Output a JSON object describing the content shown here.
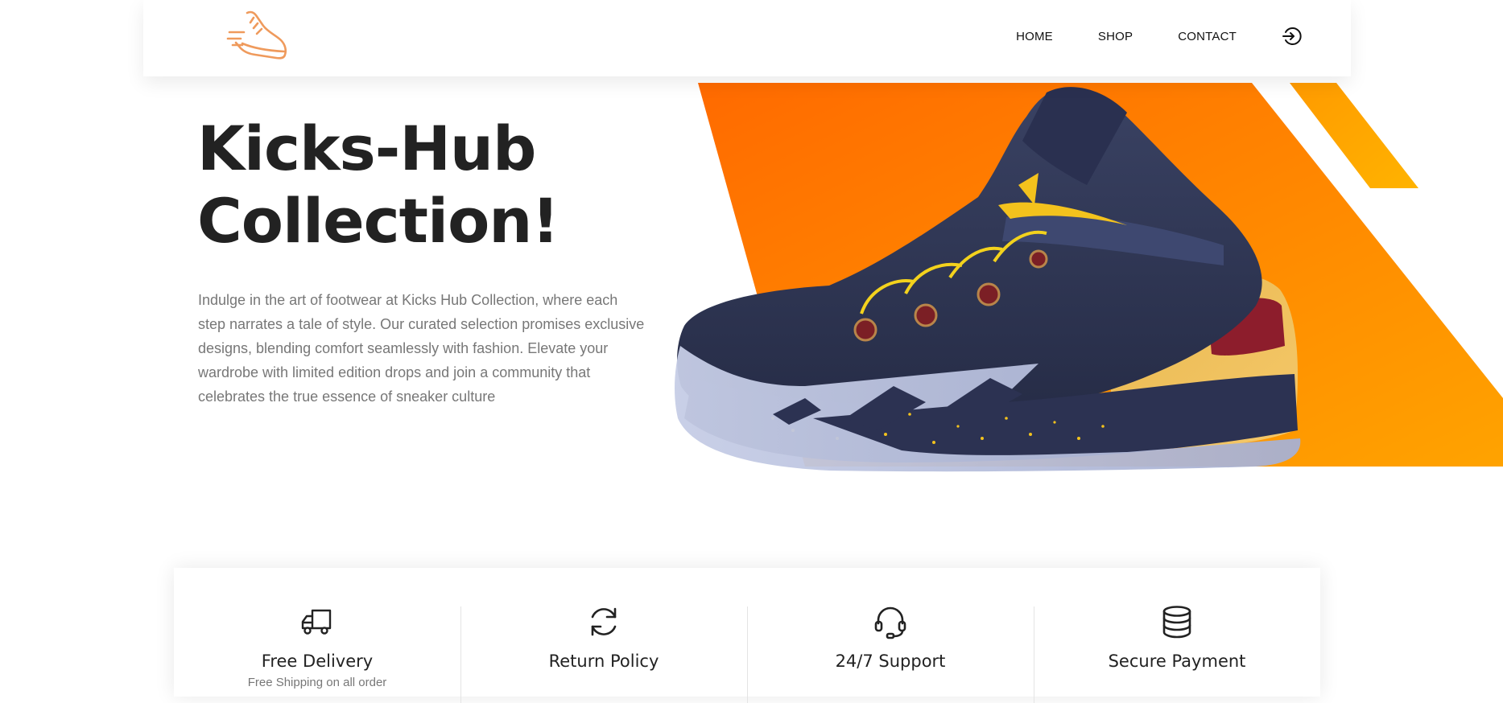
{
  "brand": {
    "logo_icon": "running-shoe-icon",
    "accent_color": "#ff7b00"
  },
  "nav": {
    "items": [
      {
        "label": "HOME"
      },
      {
        "label": "SHOP"
      },
      {
        "label": "CONTACT"
      }
    ],
    "login_icon": "login-icon"
  },
  "hero": {
    "title_line1": "Kicks-Hub",
    "title_line2": "Collection!",
    "description": "Indulge in the art of footwear at Kicks Hub Collection, where each step narrates a tale of style. Our curated selection promises exclusive designs, blending comfort seamlessly with fashion. Elevate your wardrobe with limited edition drops and join a community that celebrates the true essence of sneaker culture",
    "image_icon": "basketball-sneaker-image"
  },
  "features": [
    {
      "title": "Free Delivery",
      "subtitle": "Free Shipping on all order",
      "icon": "truck-icon"
    },
    {
      "title": "Return Policy",
      "subtitle": "",
      "icon": "refresh-icon"
    },
    {
      "title": "24/7 Support",
      "subtitle": "",
      "icon": "headset-icon"
    },
    {
      "title": "Secure Payment",
      "subtitle": "",
      "icon": "coins-icon"
    }
  ]
}
